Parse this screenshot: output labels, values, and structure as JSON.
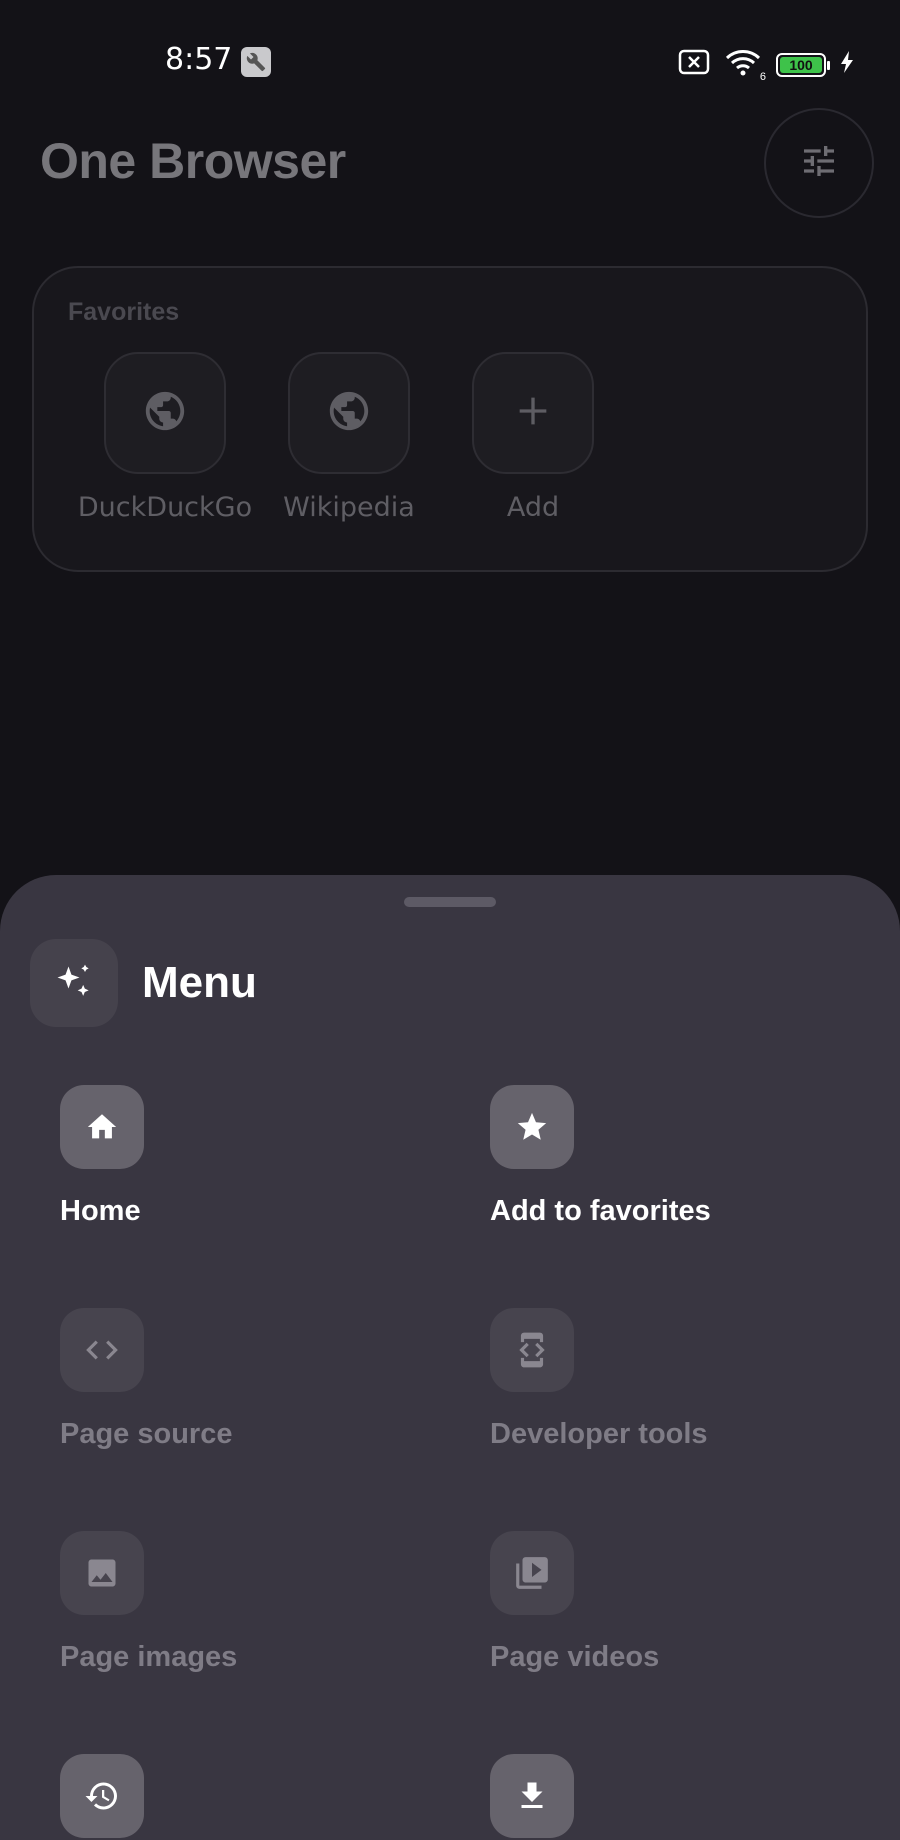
{
  "status_bar": {
    "time": "8:57",
    "battery": "100",
    "wifi_badge": "6",
    "accent_battery": "#3ec24a"
  },
  "app": {
    "title": "One Browser",
    "settings_icon": "tune-icon"
  },
  "favorites": {
    "title": "Favorites",
    "items": [
      {
        "label": "DuckDuckGo",
        "icon": "globe-icon"
      },
      {
        "label": "Wikipedia",
        "icon": "globe-icon"
      },
      {
        "label": "Add",
        "icon": "plus-icon"
      }
    ]
  },
  "menu": {
    "title": "Menu",
    "icon": "sparkle-icon",
    "items": [
      {
        "label": "Home",
        "icon": "home-icon",
        "enabled": true
      },
      {
        "label": "Add to favorites",
        "icon": "star-icon",
        "enabled": true
      },
      {
        "label": "Page source",
        "icon": "code-icon",
        "enabled": false
      },
      {
        "label": "Developer tools",
        "icon": "developer-mode-icon",
        "enabled": false
      },
      {
        "label": "Page images",
        "icon": "image-icon",
        "enabled": false
      },
      {
        "label": "Page videos",
        "icon": "video-library-icon",
        "enabled": false
      },
      {
        "label": "",
        "icon": "history-icon",
        "enabled": true
      },
      {
        "label": "",
        "icon": "download-icon",
        "enabled": true
      }
    ]
  },
  "colors": {
    "background": "#131217",
    "sheet": "#393641",
    "tile_enabled": "#66636c",
    "tile_disabled": "#47444e"
  }
}
